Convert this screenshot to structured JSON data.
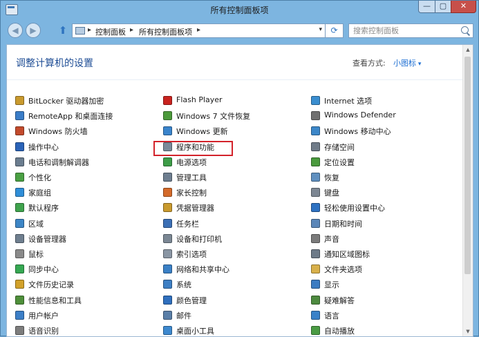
{
  "window": {
    "title": "所有控制面板项",
    "buttons": {
      "minimize": "—",
      "maximize": "▢",
      "close": "✕"
    }
  },
  "navbar": {
    "back": "◀",
    "forward": "▶",
    "up": "⬆",
    "breadcrumbs": [
      "控制面板",
      "所有控制面板项"
    ],
    "separator": "▸",
    "dropdown": "▾",
    "refresh": "⟳",
    "search_placeholder": "搜索控制面板"
  },
  "content": {
    "heading": "调整计算机的设置",
    "view_by_label": "查看方式:",
    "view_by_value": "小图标",
    "columns": [
      [
        {
          "label": "BitLocker 驱动器加密",
          "icon": "bitlocker-icon",
          "color": "#c99a2e"
        },
        {
          "label": "RemoteApp 和桌面连接",
          "icon": "remoteapp-icon",
          "color": "#3a7dc8"
        },
        {
          "label": "Windows 防火墙",
          "icon": "firewall-icon",
          "color": "#c24a2c"
        },
        {
          "label": "操作中心",
          "icon": "action-center-flag-icon",
          "color": "#2a63b8"
        },
        {
          "label": "电话和调制解调器",
          "icon": "phone-modem-icon",
          "color": "#6b7d8f"
        },
        {
          "label": "个性化",
          "icon": "personalization-icon",
          "color": "#4aa043"
        },
        {
          "label": "家庭组",
          "icon": "homegroup-icon",
          "color": "#2f8ed8"
        },
        {
          "label": "默认程序",
          "icon": "default-programs-icon",
          "color": "#3fa34d"
        },
        {
          "label": "区域",
          "icon": "region-icon",
          "color": "#3d86c6"
        },
        {
          "label": "设备管理器",
          "icon": "device-manager-icon",
          "color": "#6f7f8f"
        },
        {
          "label": "鼠标",
          "icon": "mouse-icon",
          "color": "#8a8a8a"
        },
        {
          "label": "同步中心",
          "icon": "sync-center-icon",
          "color": "#35a852"
        },
        {
          "label": "文件历史记录",
          "icon": "file-history-icon",
          "color": "#d2a12a"
        },
        {
          "label": "性能信息和工具",
          "icon": "performance-icon",
          "color": "#4e8f3a"
        },
        {
          "label": "用户帐户",
          "icon": "user-accounts-icon",
          "color": "#3c7fc7"
        },
        {
          "label": "语音识别",
          "icon": "speech-recognition-icon",
          "color": "#7d7d7d"
        }
      ],
      [
        {
          "label": "Flash Player",
          "icon": "flash-player-icon",
          "color": "#c9231f"
        },
        {
          "label": "Windows 7 文件恢复",
          "icon": "file-recovery-icon",
          "color": "#4c9a3b"
        },
        {
          "label": "Windows 更新",
          "icon": "windows-update-icon",
          "color": "#3a84cc"
        },
        {
          "label": "程序和功能",
          "icon": "programs-features-icon",
          "color": "#7a8a9a"
        },
        {
          "label": "电源选项",
          "icon": "power-options-icon",
          "color": "#3d9d48"
        },
        {
          "label": "管理工具",
          "icon": "admin-tools-icon",
          "color": "#6e7e90"
        },
        {
          "label": "家长控制",
          "icon": "parental-controls-icon",
          "color": "#d46a2a"
        },
        {
          "label": "凭据管理器",
          "icon": "credential-manager-icon",
          "color": "#c99a2e"
        },
        {
          "label": "任务栏",
          "icon": "taskbar-icon",
          "color": "#3b6fb5"
        },
        {
          "label": "设备和打印机",
          "icon": "devices-printers-icon",
          "color": "#7b8794"
        },
        {
          "label": "索引选项",
          "icon": "indexing-options-icon",
          "color": "#8a96a4"
        },
        {
          "label": "网络和共享中心",
          "icon": "network-sharing-icon",
          "color": "#3a80c6"
        },
        {
          "label": "系统",
          "icon": "system-icon",
          "color": "#3e7fc4"
        },
        {
          "label": "颜色管理",
          "icon": "color-management-icon",
          "color": "#2f6fbe"
        },
        {
          "label": "邮件",
          "icon": "mail-icon",
          "color": "#5a7fa8"
        },
        {
          "label": "桌面小工具",
          "icon": "desktop-gadgets-icon",
          "color": "#3d89cf"
        }
      ],
      [
        {
          "label": "Internet 选项",
          "icon": "internet-options-icon",
          "color": "#3a8ed0"
        },
        {
          "label": "Windows Defender",
          "icon": "windows-defender-icon",
          "color": "#707070"
        },
        {
          "label": "Windows 移动中心",
          "icon": "mobility-center-icon",
          "color": "#3c87c9"
        },
        {
          "label": "存储空间",
          "icon": "storage-spaces-icon",
          "color": "#6f7b88"
        },
        {
          "label": "定位设置",
          "icon": "location-settings-icon",
          "color": "#4a9a3e"
        },
        {
          "label": "恢复",
          "icon": "recovery-icon",
          "color": "#5f8fbf"
        },
        {
          "label": "键盘",
          "icon": "keyboard-icon",
          "color": "#7d8793"
        },
        {
          "label": "轻松使用设置中心",
          "icon": "ease-of-access-icon",
          "color": "#2e72c2"
        },
        {
          "label": "日期和时间",
          "icon": "date-time-icon",
          "color": "#5a86b8"
        },
        {
          "label": "声音",
          "icon": "sound-icon",
          "color": "#7b7b7b"
        },
        {
          "label": "通知区域图标",
          "icon": "notification-area-icon",
          "color": "#6d7a88"
        },
        {
          "label": "文件夹选项",
          "icon": "folder-options-icon",
          "color": "#d8b04a"
        },
        {
          "label": "显示",
          "icon": "display-icon",
          "color": "#3c7cc2"
        },
        {
          "label": "疑难解答",
          "icon": "troubleshooting-icon",
          "color": "#4d8a3f"
        },
        {
          "label": "语言",
          "icon": "language-icon",
          "color": "#3b82c8"
        },
        {
          "label": "自动播放",
          "icon": "autoplay-icon",
          "color": "#4a9b44"
        }
      ]
    ]
  },
  "scrollbar": {
    "up": "▲",
    "down": "▼"
  }
}
